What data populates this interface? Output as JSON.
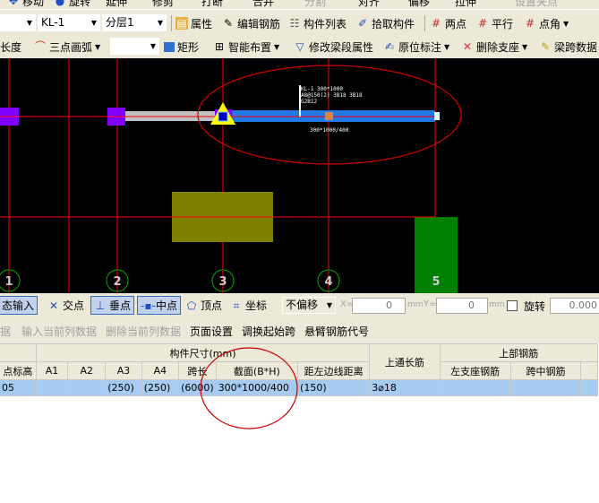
{
  "toolbar_top": {
    "items": [
      "移动",
      "旋转",
      "延伸",
      "修剪",
      "打断",
      "合并",
      "分割",
      "对齐",
      "偏移",
      "拉伸",
      "设置夹点"
    ]
  },
  "toolbar1": {
    "dropdown_blank": "",
    "component": "KL-1",
    "layer": "分层1",
    "items": [
      "属性",
      "编辑钢筋",
      "构件列表",
      "拾取构件",
      "两点",
      "平行",
      "点角"
    ]
  },
  "toolbar2": {
    "items": [
      "加长度",
      "三点画弧",
      "矩形",
      "智能布置",
      "修改梁段属性",
      "原位标注",
      "删除支座",
      "梁跨数据"
    ],
    "dropdown_blank": ""
  },
  "canvas": {
    "annotation": [
      "KL-1 300*1000",
      "A8@150(2) 3B18 3B18",
      "G2B12"
    ],
    "section_label": "300*1000/400",
    "axes": [
      "1",
      "2",
      "3",
      "4",
      "5"
    ],
    "colors": {
      "background": "#000000",
      "grid": "#ff0000",
      "beam": "#1e78e6",
      "column": "#8000ff",
      "highlight": "#ffff00",
      "mark": "#cc0000"
    }
  },
  "snapbar": {
    "input_mode": "态输入",
    "intersect": "交点",
    "perpendicular": "垂点",
    "midpoint": "中点",
    "vertex": "顶点",
    "coordinate": "坐标",
    "offset": "不偏移",
    "x_label": "X=",
    "x_value": "0",
    "y_label": "Y=",
    "y_value": "0",
    "unit": "mm",
    "rotate": "旋转",
    "rotate_value": "0.000"
  },
  "menu": {
    "items": [
      "数据",
      "输入当前列数据",
      "删除当前列数据",
      "页面设置",
      "调换起始跨",
      "悬臂钢筋代号"
    ]
  },
  "table": {
    "group_size": "构件尺寸(mm)",
    "group_top": "上部钢筋",
    "continuous": "上通长筋",
    "headers": [
      "点标高",
      "A1",
      "A2",
      "A3",
      "A4",
      "跨长",
      "截面(B*H)",
      "距左边线距离",
      "左支座钢筋",
      "跨中钢筋"
    ],
    "rows": [
      [
        "05",
        "",
        "",
        "(250)",
        "(250)",
        "(6000)",
        "300*1000/400",
        "(150)",
        "3⌀18",
        "",
        ""
      ]
    ]
  }
}
